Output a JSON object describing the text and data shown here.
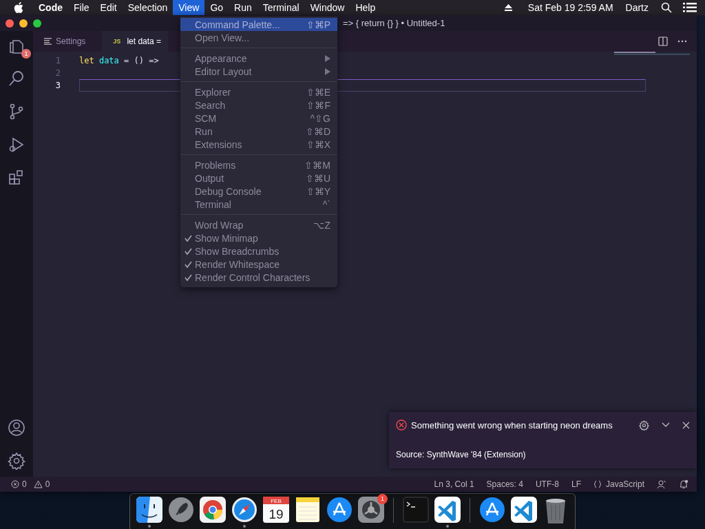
{
  "menubar": {
    "items": [
      {
        "label": "Code",
        "kind": "app",
        "selected": false
      },
      {
        "label": "File",
        "kind": "menu",
        "selected": false
      },
      {
        "label": "Edit",
        "kind": "menu",
        "selected": false
      },
      {
        "label": "Selection",
        "kind": "menu",
        "selected": false
      },
      {
        "label": "View",
        "kind": "menu",
        "selected": true
      },
      {
        "label": "Go",
        "kind": "menu",
        "selected": false
      },
      {
        "label": "Run",
        "kind": "menu",
        "selected": false
      },
      {
        "label": "Terminal",
        "kind": "menu",
        "selected": false
      },
      {
        "label": "Window",
        "kind": "menu",
        "selected": false
      },
      {
        "label": "Help",
        "kind": "menu",
        "selected": false
      }
    ],
    "clock": "Sat Feb 19  2:59 AM",
    "user": "Dartz"
  },
  "window": {
    "title": "=> { return {} } • Untitled-1"
  },
  "activity_bar": {
    "top": [
      {
        "kind": "files",
        "badge": "1"
      },
      {
        "kind": "search"
      },
      {
        "kind": "source-control"
      },
      {
        "kind": "run"
      },
      {
        "kind": "extensions"
      }
    ],
    "bottom": [
      {
        "kind": "account"
      },
      {
        "kind": "settings"
      }
    ]
  },
  "tabs": [
    {
      "kind": "settings",
      "label": "Settings",
      "selected": false
    },
    {
      "kind": "js",
      "icon_text": "JS",
      "label": "let data =",
      "selected": true
    }
  ],
  "editor": {
    "lines": [
      {
        "number": "1",
        "current": false,
        "tokens": [
          {
            "text": "let",
            "kind": "keyword"
          },
          {
            "text": "data",
            "kind": "variable"
          },
          {
            "text": "= () =>",
            "kind": "operator"
          }
        ]
      },
      {
        "number": "2",
        "current": false
      },
      {
        "number": "3",
        "current": true
      }
    ]
  },
  "view_menu": {
    "groups": [
      {
        "items": [
          {
            "label": "Command Palette...",
            "shortcut": "⇧⌘P",
            "selected": true,
            "checked": false,
            "submenu": false
          },
          {
            "label": "Open View...",
            "selected": false,
            "checked": false,
            "submenu": false
          }
        ]
      },
      {
        "items": [
          {
            "label": "Appearance",
            "selected": false,
            "checked": false,
            "submenu": true
          },
          {
            "label": "Editor Layout",
            "selected": false,
            "checked": false,
            "submenu": true
          }
        ]
      },
      {
        "items": [
          {
            "label": "Explorer",
            "shortcut": "⇧⌘E",
            "selected": false,
            "checked": false,
            "submenu": false
          },
          {
            "label": "Search",
            "shortcut": "⇧⌘F",
            "selected": false,
            "checked": false,
            "submenu": false
          },
          {
            "label": "SCM",
            "shortcut": "^⇧G",
            "selected": false,
            "checked": false,
            "submenu": false
          },
          {
            "label": "Run",
            "shortcut": "⇧⌘D",
            "selected": false,
            "checked": false,
            "submenu": false
          },
          {
            "label": "Extensions",
            "shortcut": "⇧⌘X",
            "selected": false,
            "checked": false,
            "submenu": false
          }
        ]
      },
      {
        "items": [
          {
            "label": "Problems",
            "shortcut": "⇧⌘M",
            "selected": false,
            "checked": false,
            "submenu": false
          },
          {
            "label": "Output",
            "shortcut": "⇧⌘U",
            "selected": false,
            "checked": false,
            "submenu": false
          },
          {
            "label": "Debug Console",
            "shortcut": "⇧⌘Y",
            "selected": false,
            "checked": false,
            "submenu": false
          },
          {
            "label": "Terminal",
            "shortcut": "^`",
            "selected": false,
            "checked": false,
            "submenu": false
          }
        ]
      },
      {
        "items": [
          {
            "label": "Word Wrap",
            "shortcut": "⌥Z",
            "selected": false,
            "checked": false,
            "submenu": false
          },
          {
            "label": "Show Minimap",
            "selected": false,
            "checked": true,
            "submenu": false
          },
          {
            "label": "Show Breadcrumbs",
            "selected": false,
            "checked": true,
            "submenu": false
          },
          {
            "label": "Render Whitespace",
            "selected": false,
            "checked": true,
            "submenu": false
          },
          {
            "label": "Render Control Characters",
            "selected": false,
            "checked": true,
            "submenu": false
          }
        ]
      }
    ]
  },
  "notification": {
    "message": "Something went wrong when starting neon dreams",
    "source": "Source: SynthWave '84 (Extension)"
  },
  "status_bar": {
    "errors": "0",
    "warnings": "0",
    "items": [
      {
        "kind": "text",
        "label": "Ln 3, Col 1"
      },
      {
        "kind": "text",
        "label": "Spaces: 4"
      },
      {
        "kind": "text",
        "label": "UTF-8"
      },
      {
        "kind": "text",
        "label": "LF"
      },
      {
        "kind": "language",
        "label": "JavaScript"
      }
    ]
  },
  "dock": {
    "items": [
      {
        "kind": "finder",
        "running": true
      },
      {
        "kind": "launchpad",
        "running": false
      },
      {
        "kind": "chrome",
        "running": false
      },
      {
        "kind": "safari",
        "running": true
      },
      {
        "kind": "calendar",
        "month": "FEB",
        "day": "19",
        "running": false
      },
      {
        "kind": "notes",
        "running": false
      },
      {
        "kind": "appstore",
        "running": false
      },
      {
        "kind": "preferences",
        "badge": "1",
        "running": false
      },
      {
        "kind": "separator"
      },
      {
        "kind": "terminal",
        "running": false
      },
      {
        "kind": "vscode",
        "running": true
      },
      {
        "kind": "separator"
      },
      {
        "kind": "appstore",
        "running": false
      },
      {
        "kind": "vscode",
        "running": false
      },
      {
        "kind": "trash",
        "running": false
      }
    ]
  }
}
